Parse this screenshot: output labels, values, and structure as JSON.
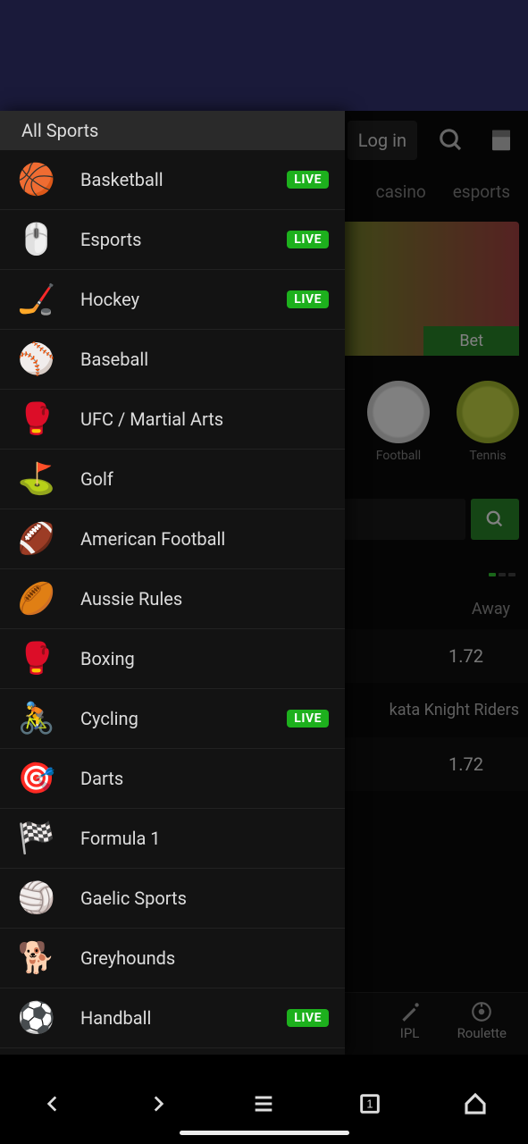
{
  "header": {
    "login_label": "Log in"
  },
  "tabs": {
    "casino": "casino",
    "esports": "esports"
  },
  "promo": {
    "bet_label": "Bet"
  },
  "sport_chips": {
    "football": "Football",
    "tennis": "Tennis"
  },
  "odds": {
    "away_label": "Away",
    "value1": "1.72",
    "match": "kata Knight Riders",
    "value2": "1.72"
  },
  "quick": {
    "ipl": "IPL",
    "roulette": "Roulette"
  },
  "sidebar": {
    "header": "All Sports",
    "live": "LIVE",
    "items": [
      {
        "label": "Basketball",
        "emoji": "🏀",
        "live": true
      },
      {
        "label": "Esports",
        "emoji": "🖱️",
        "live": true
      },
      {
        "label": "Hockey",
        "emoji": "🏒",
        "live": true
      },
      {
        "label": "Baseball",
        "emoji": "⚾",
        "live": false
      },
      {
        "label": "UFC / Martial Arts",
        "emoji": "🥊",
        "live": false
      },
      {
        "label": "Golf",
        "emoji": "⛳",
        "live": false
      },
      {
        "label": "American Football",
        "emoji": "🏈",
        "live": false
      },
      {
        "label": "Aussie Rules",
        "emoji": "🏉",
        "live": false
      },
      {
        "label": "Boxing",
        "emoji": "🥊",
        "live": false
      },
      {
        "label": "Cycling",
        "emoji": "🚴",
        "live": true
      },
      {
        "label": "Darts",
        "emoji": "🎯",
        "live": false
      },
      {
        "label": "Formula 1",
        "emoji": "🏁",
        "live": false
      },
      {
        "label": "Gaelic Sports",
        "emoji": "🏐",
        "live": false
      },
      {
        "label": "Greyhounds",
        "emoji": "🐕",
        "live": false
      },
      {
        "label": "Handball",
        "emoji": "⚽",
        "live": true
      }
    ]
  }
}
